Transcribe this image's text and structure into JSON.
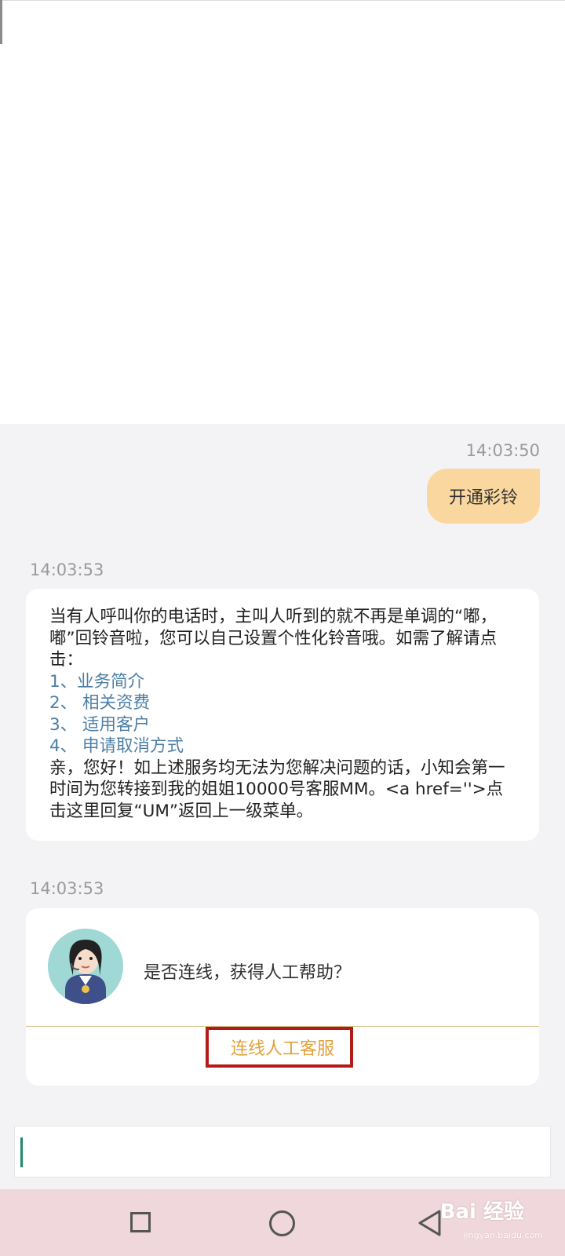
{
  "messages": {
    "user_time": "14:03:50",
    "user_text": "开通彩铃",
    "bot_time_1": "14:03:53",
    "bot_intro": "当有人呼叫你的电话时，主叫人听到的就不再是单调的“嘟，嘟”回铃音啦，您可以自己设置个性化铃音哦。如需了解请点击：",
    "bot_links": [
      "1、业务简介",
      "2、 相关资费",
      "3、 适用客户",
      "4、 申请取消方式"
    ],
    "bot_outro": "亲，您好！如上述服务均无法为您解决问题的话，小知会第一时间为您转接到我的姐姐10000号客服MM。<a href=''>点击这里回复“UM”返回上一级菜单。",
    "bot_time_2": "14:03:53",
    "card_question": "是否连线，获得人工帮助？",
    "card_button": "连线人工客服"
  },
  "nav": {
    "icons": [
      "recent-apps-icon",
      "home-icon",
      "back-icon"
    ]
  },
  "watermark": {
    "text": "Bai 经验",
    "sub": "jingyan.baidu.com"
  },
  "colors": {
    "user_bubble": "#fad79e",
    "link": "#4d7fa5",
    "connect_button": "#e1a13b",
    "highlight_box": "#b31b16",
    "nav_bar": "#efd7dc"
  }
}
